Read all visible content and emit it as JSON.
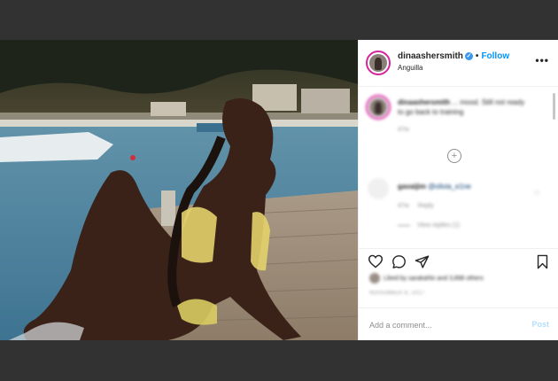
{
  "post": {
    "username": "dinaashersmith",
    "verified_icon": "verified-badge-icon",
    "separator": "•",
    "follow_label": "Follow",
    "location": "Anguilla",
    "more_icon": "more-options-icon",
    "more_label": "•••"
  },
  "comments": {
    "caption": {
      "username": "dinaashersmith",
      "text": "... mood. Still not ready to go back to training",
      "age": "47w"
    },
    "load_more_icon": "plus-circle-icon",
    "load_more_label": "+",
    "reply": {
      "username": "gavaijim",
      "mention": "@olivia_e1ne",
      "age": "47w",
      "reply_label": "Reply",
      "view_replies": "View replies (1)"
    }
  },
  "actions": {
    "like_icon": "heart-icon",
    "comment_icon": "comment-icon",
    "share_icon": "share-icon",
    "save_icon": "bookmark-icon"
  },
  "likes": {
    "text": "Liked by sarakahlo and 3,898 others"
  },
  "date": "NOVEMBER 8, 2017",
  "add_comment": {
    "placeholder": "Add a comment...",
    "post_label": "Post"
  }
}
